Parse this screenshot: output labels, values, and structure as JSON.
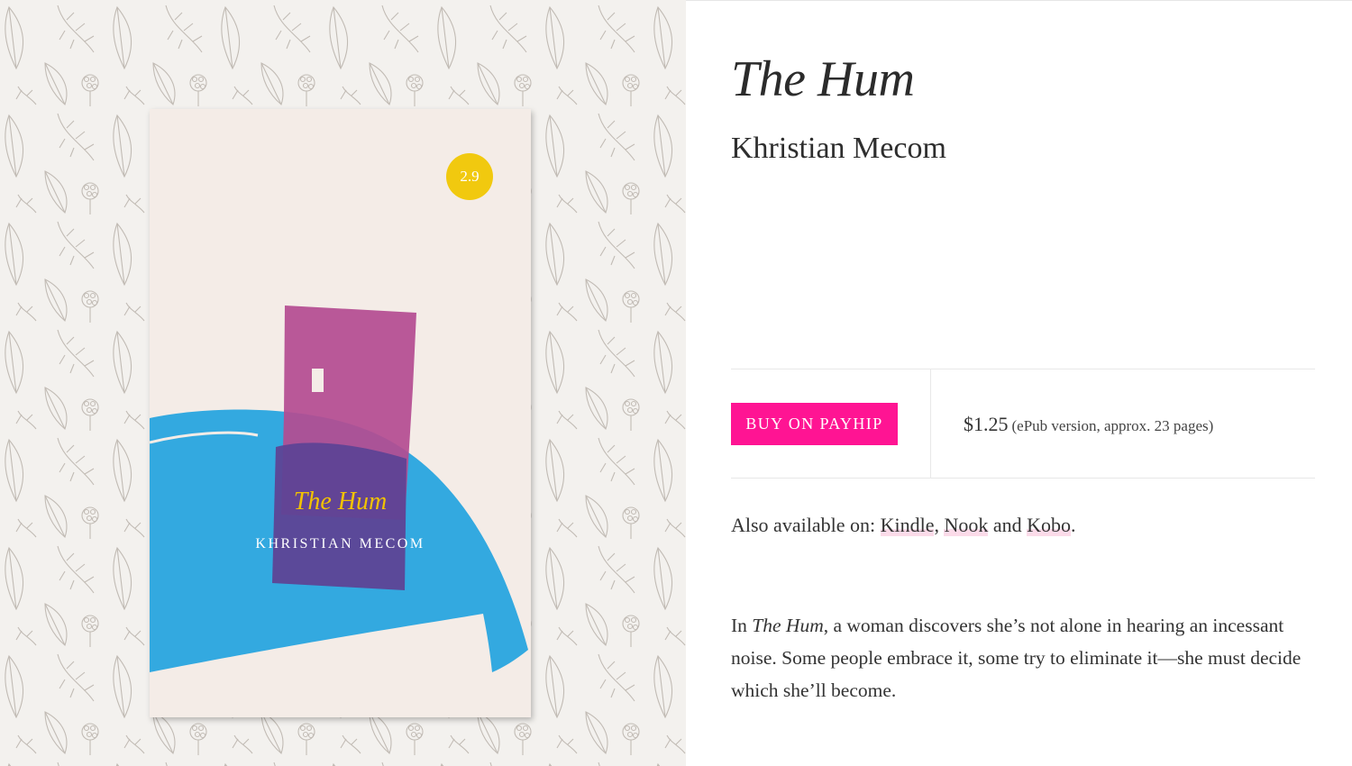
{
  "book": {
    "title": "The Hum",
    "author": "Khristian Mecom",
    "cover": {
      "badge": "2.9",
      "title": "The Hum",
      "author": "KHRISTIAN MECOM",
      "colors": {
        "background": "#f4ece7",
        "blue": "#33a9e0",
        "magenta": "#b44c91",
        "purple": "#5e4395",
        "badge": "#f1c90f"
      }
    }
  },
  "purchase": {
    "button_label": "BUY ON PAYHIP",
    "price": "$1.25",
    "price_note": "(ePub version, approx. 23 pages)",
    "accent_color": "#ff1493"
  },
  "availability": {
    "prefix": "Also available on: ",
    "stores": [
      "Kindle",
      "Nook",
      "Kobo"
    ],
    "sep1": ", ",
    "sep2": " and ",
    "suffix": "."
  },
  "description": {
    "prefix": "In ",
    "title_em": "The Hum",
    "body": ", a woman discovers she’s not alone in hearing an incessant noise. Some people embrace it, some try to eliminate it—she must decide which she’ll become."
  }
}
